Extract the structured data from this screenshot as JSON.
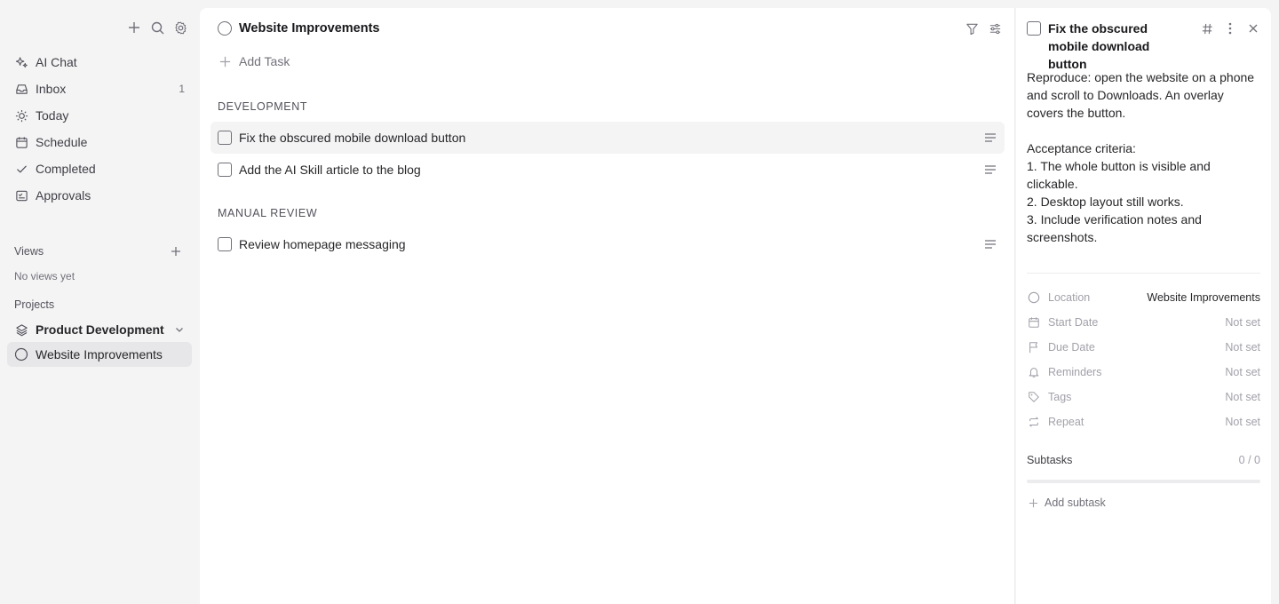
{
  "sidebar": {
    "nav": [
      {
        "label": "AI Chat",
        "icon": "sparkles-icon",
        "count": ""
      },
      {
        "label": "Inbox",
        "icon": "inbox-icon",
        "count": "1"
      },
      {
        "label": "Today",
        "icon": "sun-icon",
        "count": ""
      },
      {
        "label": "Schedule",
        "icon": "calendar-icon",
        "count": ""
      },
      {
        "label": "Completed",
        "icon": "check-icon",
        "count": ""
      },
      {
        "label": "Approvals",
        "icon": "approval-icon",
        "count": ""
      }
    ],
    "views_label": "Views",
    "no_views": "No views yet",
    "projects_label": "Projects",
    "projects": [
      {
        "label": "Product Development",
        "icon": "layers-icon"
      },
      {
        "label": "Website Improvements",
        "icon": "circle-icon"
      }
    ]
  },
  "main": {
    "title": "Website Improvements",
    "add_task": "Add Task",
    "groups": [
      {
        "label": "DEVELOPMENT",
        "tasks": [
          {
            "text": "Fix the obscured mobile download button"
          },
          {
            "text": "Add the AI Skill article to the blog"
          }
        ]
      },
      {
        "label": "MANUAL REVIEW",
        "tasks": [
          {
            "text": "Review homepage messaging"
          }
        ]
      }
    ]
  },
  "detail": {
    "title": "Fix the obscured mobile download button",
    "description": [
      "Reproduce: open the website on a phone and scroll to Downloads. An overlay covers the button.",
      "",
      "Acceptance criteria:",
      "1. The whole button is visible and clickable.",
      "2. Desktop layout still works.",
      "3. Include verification notes and screenshots."
    ],
    "props": [
      {
        "label": "Location",
        "value": "Website Improvements",
        "icon": "circle-icon"
      },
      {
        "label": "Start Date",
        "value": "Not set",
        "icon": "calendar-icon"
      },
      {
        "label": "Due Date",
        "value": "Not set",
        "icon": "flag-icon"
      },
      {
        "label": "Reminders",
        "value": "Not set",
        "icon": "bell-icon"
      },
      {
        "label": "Tags",
        "value": "Not set",
        "icon": "tag-icon"
      },
      {
        "label": "Repeat",
        "value": "Not set",
        "icon": "repeat-icon"
      }
    ],
    "subtasks_label": "Subtasks",
    "subtasks_count": "0 / 0",
    "subtasks_progress": 0,
    "add_subtask": "Add subtask"
  }
}
